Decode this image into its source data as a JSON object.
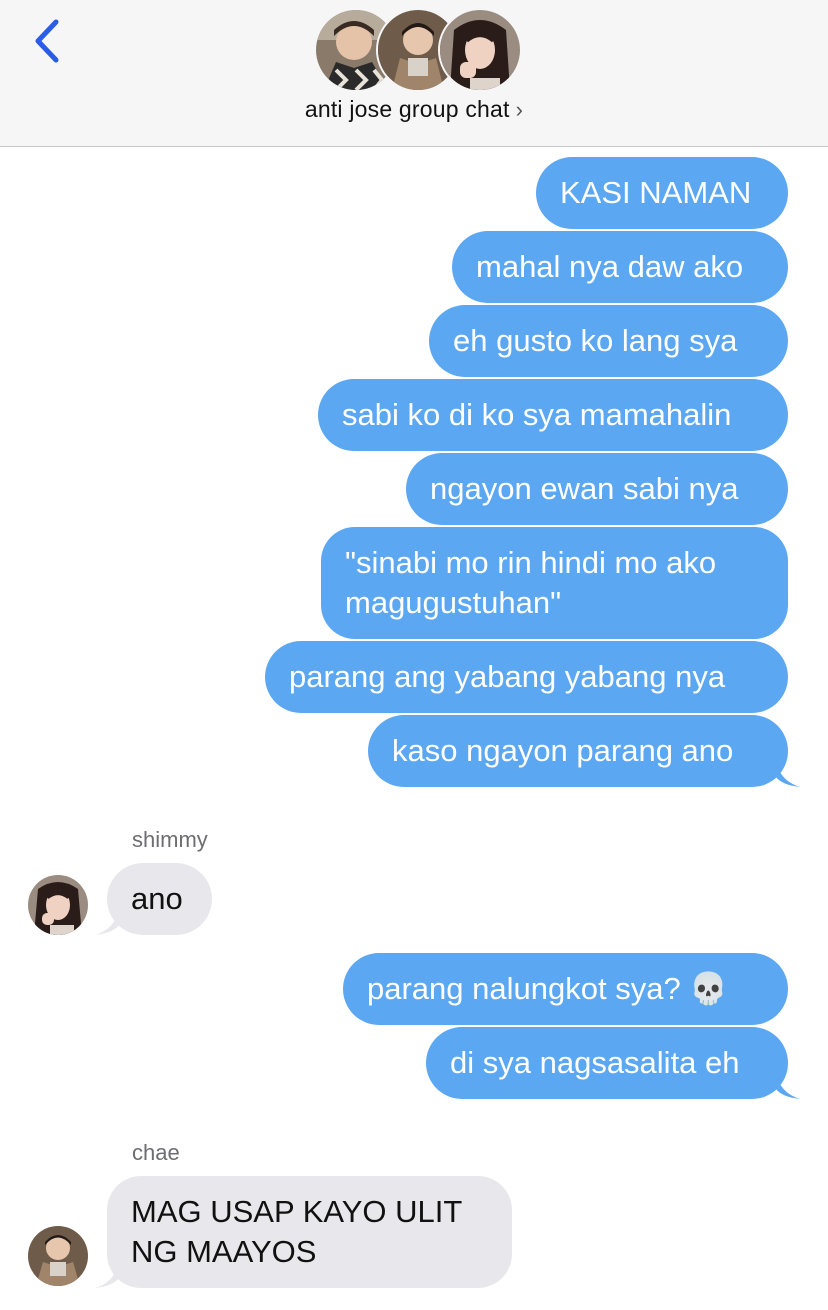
{
  "header": {
    "back_icon": "chevron-left-icon",
    "title": "anti jose group chat",
    "title_chevron": "›",
    "accent": "#2b5ce6"
  },
  "colors": {
    "sent_bubble": "#5ba7f1",
    "received_bubble": "#e8e8ec"
  },
  "messages": {
    "m1": "KASI NAMAN",
    "m2": "mahal nya daw ako",
    "m3": "eh gusto ko lang sya",
    "m4": "sabi ko di ko sya mamahalin",
    "m5": "ngayon ewan sabi nya",
    "m6a": "\"sinabi mo rin hindi mo ako",
    "m6b": "magugustuhan\"",
    "m7": "parang ang yabang yabang nya",
    "m8": "kaso ngayon parang ano",
    "s1_name": "shimmy",
    "s1_text": "ano",
    "m9": "parang nalungkot sya? 💀",
    "m10": "di sya nagsasalita eh",
    "s2_name": "chae",
    "s2_text_a": "MAG USAP KAYO ULIT",
    "s2_text_b": "NG MAAYOS"
  }
}
